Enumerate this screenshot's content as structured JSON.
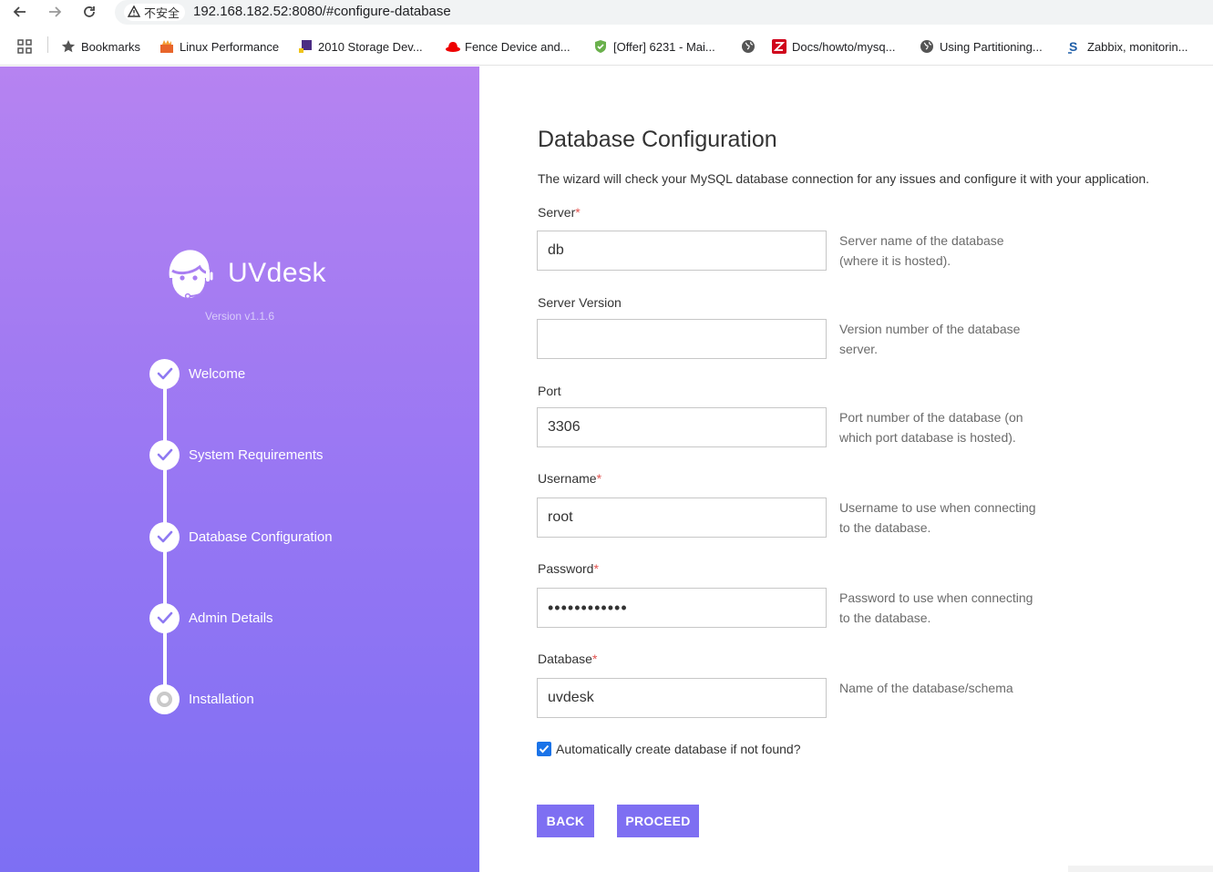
{
  "browser": {
    "security_label": "不安全",
    "url": "192.168.182.52:8080/#configure-database",
    "bookmarks": [
      {
        "label": "Bookmarks",
        "icon": "star-icon"
      },
      {
        "label": "Linux Performance",
        "icon": "flame-icon"
      },
      {
        "label": "2010 Storage Dev...",
        "icon": "storage-icon"
      },
      {
        "label": "Fence Device and...",
        "icon": "redhat-icon"
      },
      {
        "label": "[Offer] 6231 - Mai...",
        "icon": "shield-icon"
      },
      {
        "label": "",
        "icon": "globe-icon"
      },
      {
        "label": "Docs/howto/mysq...",
        "icon": "z-icon"
      },
      {
        "label": "Using Partitioning...",
        "icon": "globe-icon"
      },
      {
        "label": "Zabbix, monitorin...",
        "icon": "s-icon"
      }
    ]
  },
  "sidebar": {
    "brand": "UVdesk",
    "version": "Version v1.1.6",
    "steps": [
      {
        "label": "Welcome",
        "status": "done"
      },
      {
        "label": "System Requirements",
        "status": "done"
      },
      {
        "label": "Database Configuration",
        "status": "done"
      },
      {
        "label": "Admin Details",
        "status": "done"
      },
      {
        "label": "Installation",
        "status": "pending"
      }
    ]
  },
  "main": {
    "title": "Database Configuration",
    "description": "The wizard will check your MySQL database connection for any issues and configure it with your application.",
    "fields": [
      {
        "label": "Server",
        "required": "*",
        "value": "db",
        "hint": "Server name of the database (where it is hosted)."
      },
      {
        "label": "Server Version",
        "required": "",
        "value": "",
        "hint": "Version number of the database server."
      },
      {
        "label": "Port",
        "required": "",
        "value": "3306",
        "hint": "Port number of the database (on which port database is hosted)."
      },
      {
        "label": "Username",
        "required": "*",
        "value": "root",
        "hint": "Username to use when connecting to the database."
      },
      {
        "label": "Password",
        "required": "*",
        "value": "••••••••••••",
        "hint": "Password to use when connecting to the database."
      },
      {
        "label": "Database",
        "required": "*",
        "value": "uvdesk",
        "hint": "Name of the database/schema"
      }
    ],
    "auto_create_label": "Automatically create database if not found?",
    "auto_create_checked": true,
    "back_label": "BACK",
    "proceed_label": "PROCEED"
  },
  "colors": {
    "accent": "#7e6ff2",
    "required": "#e2524f",
    "gradient_top": "#b683f1",
    "gradient_bottom": "#7d6ff3"
  }
}
